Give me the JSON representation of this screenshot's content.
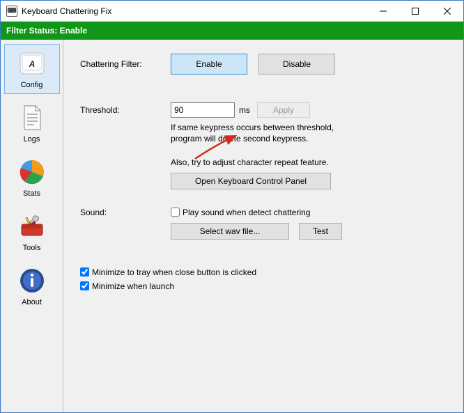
{
  "window": {
    "title": "Keyboard Chattering Fix"
  },
  "status": {
    "text": "Filter Status: Enable"
  },
  "sidebar": {
    "items": [
      {
        "label": "Config"
      },
      {
        "label": "Logs"
      },
      {
        "label": "Stats"
      },
      {
        "label": "Tools"
      },
      {
        "label": "About"
      }
    ]
  },
  "config": {
    "filter_label": "Chattering Filter:",
    "enable": "Enable",
    "disable": "Disable",
    "threshold_label": "Threshold:",
    "threshold_value": "90",
    "threshold_unit": "ms",
    "apply": "Apply",
    "threshold_hint1": "If same keypress occurs between threshold,",
    "threshold_hint2": "program will delete second keypress.",
    "repeat_hint": "Also, try to adjust character repeat feature.",
    "open_panel": "Open Keyboard Control Panel",
    "sound_label": "Sound:",
    "play_sound": "Play sound when detect chattering",
    "select_wav": "Select wav file...",
    "test": "Test",
    "min_tray": "Minimize to tray when close button is clicked",
    "min_launch": "Minimize when launch"
  }
}
